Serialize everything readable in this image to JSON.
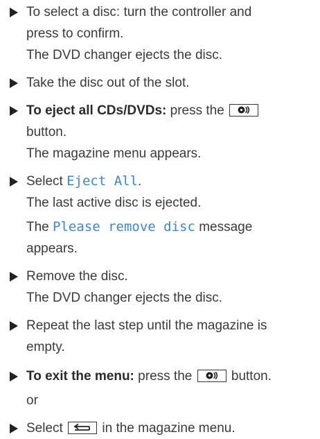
{
  "steps": [
    {
      "lines": [
        "To select a disc: turn the controller and",
        "press to confirm.",
        "The DVD changer ejects the disc."
      ]
    },
    {
      "lines": [
        "Take the disc out of the slot."
      ]
    },
    {
      "bold": "To eject all CDs/DVDs:",
      "text_before_button": "press the",
      "button_icon": "disc-eject-icon",
      "line2": "button.",
      "line3": "The magazine menu appears."
    },
    {
      "prefix": "Select",
      "display_text": "Eject All",
      "suffix": ".",
      "line2": "The last active disc is ejected.",
      "line3_display": "Please remove disc",
      "line3_suffix": "message",
      "line4": "appears."
    },
    {
      "lines": [
        "Remove the disc.",
        "The DVD changer ejects the disc."
      ]
    },
    {
      "lines": [
        "Repeat the last step until the magazine is",
        "empty."
      ]
    },
    {
      "bold": "To exit the menu:",
      "text_before_button": "press the",
      "button_icon": "disc-eject-icon",
      "after_button": "button."
    }
  ],
  "or_text": "or",
  "last_step": {
    "prefix": "Select",
    "button_icon": "back-icon",
    "suffix": "in the magazine menu."
  }
}
